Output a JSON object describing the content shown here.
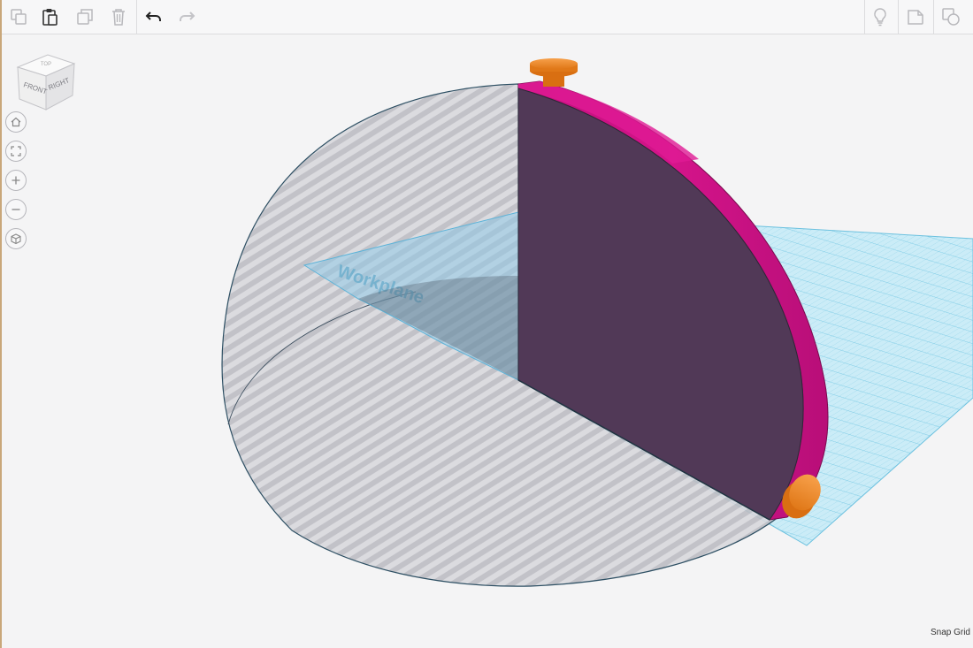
{
  "toolbar": {
    "copy_icon": "copy-icon",
    "paste_icon": "paste-icon",
    "duplicate_icon": "duplicate-icon",
    "delete_icon": "trash-icon",
    "undo_icon": "undo-arrow-icon",
    "redo_icon": "redo-arrow-icon",
    "hint_icon": "lightbulb-icon",
    "notes_icon": "note-shape-icon",
    "group_icon": "group-shapes-icon"
  },
  "view_cube": {
    "front_label": "FRONT",
    "right_label": "RIGHT",
    "top_label": "TOP"
  },
  "nav_controls": [
    "home-icon",
    "fit-view-icon",
    "zoom-in-icon",
    "zoom-out-icon",
    "perspective-icon"
  ],
  "workplane": {
    "label": "Workplane"
  },
  "footer": {
    "snap_grid_label": "Snap Grid"
  },
  "colors": {
    "half_sphere_ghost": "#c8c8ce",
    "pink_shape": "#d4148a",
    "dark_face": "#513957",
    "workplane_grid": "#8fd3ea",
    "handle_orange": "#f08a24",
    "edge_outline": "#2d4f63"
  }
}
